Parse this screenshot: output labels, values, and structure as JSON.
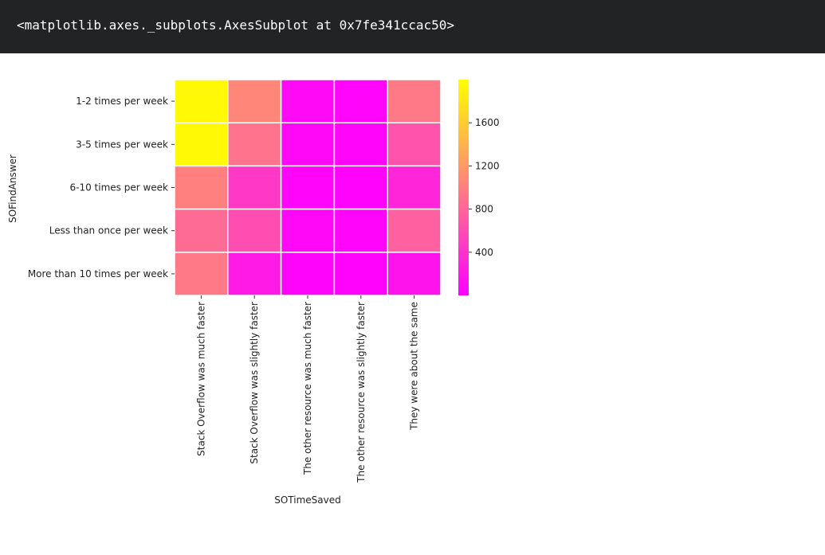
{
  "output": {
    "repr_text": "<matplotlib.axes._subplots.AxesSubplot at 0x7fe341ccac50>"
  },
  "chart_data": {
    "type": "heatmap",
    "xlabel": "SOTimeSaved",
    "ylabel": "SOFindAnswer",
    "x_categories": [
      "Stack Overflow was much faster",
      "Stack Overflow was slightly faster",
      "The other resource was much faster",
      "The other resource was slightly faster",
      "They were about the same"
    ],
    "y_categories": [
      "1-2 times per week",
      "3-5 times per week",
      "6-10 times per week",
      "Less than once per week",
      "More than 10 times per week"
    ],
    "values": [
      [
        1950,
        1050,
        80,
        40,
        950
      ],
      [
        1950,
        900,
        60,
        40,
        650
      ],
      [
        1000,
        450,
        40,
        20,
        300
      ],
      [
        850,
        600,
        60,
        40,
        750
      ],
      [
        950,
        200,
        30,
        20,
        150
      ]
    ],
    "colormap": "spring",
    "color_min": "#ff00ff",
    "color_max": "#ffff00",
    "value_range": [
      0,
      2000
    ],
    "colorbar_ticks": [
      400,
      800,
      1200,
      1600
    ],
    "linecolor": "#ffffff",
    "grid": false
  }
}
